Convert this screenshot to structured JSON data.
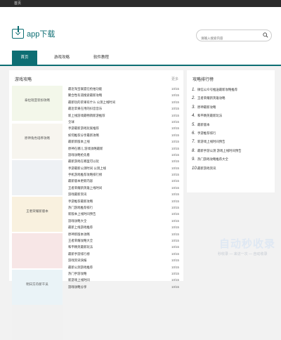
{
  "topbar": {
    "label": "首页"
  },
  "header": {
    "logo_text": "app下载"
  },
  "search": {
    "placeholder": "请输入搜索内容"
  },
  "nav": {
    "items": [
      "首页",
      "游戏攻略",
      "软件教程"
    ]
  },
  "main": {
    "title": "游戏攻略",
    "more": "更多",
    "thumbs": [
      "泰拉瑞亚装扮攻略",
      "原神角色培养攻略",
      "",
      "王者荣耀新版本",
      "",
      "明日方舟新干员",
      ""
    ],
    "rows": [
      {
        "title": "最近淘宝联盟在抢拍功能",
        "date": "10/15"
      },
      {
        "title": "聚合性有道搜索最新攻略",
        "date": "10/15"
      },
      {
        "title": "最新玩的苹果有什么 公测上线时间",
        "date": "10/15"
      },
      {
        "title": "最近苹果在用的抖音音乐",
        "date": "10/15"
      },
      {
        "title": "新上线游戏最畅销新游推荐",
        "date": "10/15"
      },
      {
        "title": "全球",
        "date": "10/15"
      },
      {
        "title": "手游最新游戏玩家推荐",
        "date": "10/15"
      },
      {
        "title": "如何推荐分享最新攻略",
        "date": "10/15"
      },
      {
        "title": "最新新版本上线",
        "date": "10/15"
      },
      {
        "title": "原神在哪儿 游戏攻略最新",
        "date": "10/15"
      },
      {
        "title": "游戏攻略抢先看",
        "date": "10/15"
      },
      {
        "title": "最新游戏在哪里可以玩",
        "date": "10/15"
      },
      {
        "title": "手游最新公测时间 公测上线",
        "date": "10/15"
      },
      {
        "title": "手机游戏推荐攻略排行榜",
        "date": "10/15"
      },
      {
        "title": "最新版本更新内容",
        "date": "10/15"
      },
      {
        "title": "王者荣耀新英雄上线时间",
        "date": "10/15"
      },
      {
        "title": "游戏最新资讯",
        "date": "10/15"
      },
      {
        "title": "手游推荐最新攻略",
        "date": "10/15"
      },
      {
        "title": "热门游戏推荐排行",
        "date": "10/15"
      },
      {
        "title": "新版本上线时间预告",
        "date": "10/15"
      },
      {
        "title": "游戏攻略大全",
        "date": "10/15"
      },
      {
        "title": "最新上线游戏推荐",
        "date": "10/15"
      },
      {
        "title": "原神新版本攻略",
        "date": "10/15"
      },
      {
        "title": "王者荣耀攻略大全",
        "date": "10/15"
      },
      {
        "title": "和平精英最新玩法",
        "date": "10/15"
      },
      {
        "title": "最新手游排行榜",
        "date": "10/15"
      },
      {
        "title": "游戏资讯快报",
        "date": "10/15"
      },
      {
        "title": "最新公测游戏推荐",
        "date": "10/15"
      },
      {
        "title": "热门手游攻略",
        "date": "10/15"
      },
      {
        "title": "新游戏上线时间",
        "date": "10/15"
      },
      {
        "title": "游戏攻略分享",
        "date": "10/15"
      }
    ]
  },
  "side": {
    "title": "攻略排行榜",
    "items": [
      {
        "n": "1.",
        "title": "微信公众号推送最新攻略推荐"
      },
      {
        "n": "2.",
        "title": "王者荣耀新英雄攻略"
      },
      {
        "n": "3.",
        "title": "原神最新攻略"
      },
      {
        "n": "4.",
        "title": "和平精英最新玩法"
      },
      {
        "n": "5.",
        "title": "最新版本"
      },
      {
        "n": "6.",
        "title": "手游推荐排行"
      },
      {
        "n": "7.",
        "title": "新游戏上线时间预告"
      },
      {
        "n": "8.",
        "title": "最新手游公测 游戏上线时间预告"
      },
      {
        "n": "9.",
        "title": "热门游戏攻略推荐大全"
      },
      {
        "n": "10.",
        "title": "最新游戏资讯"
      }
    ]
  },
  "watermark": {
    "big": "自动秒收录",
    "small": "秒收录 — 来访一次 — 自动收录"
  },
  "colors": {
    "accent": "#0d6e73"
  }
}
